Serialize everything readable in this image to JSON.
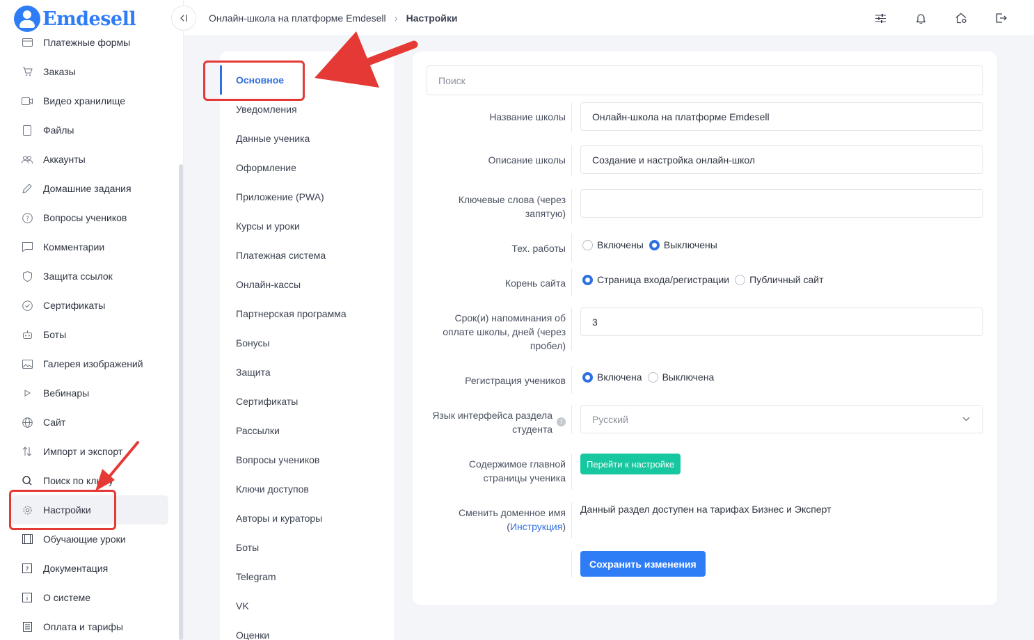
{
  "brand": {
    "name": "Emdesell"
  },
  "sidebar": {
    "items": [
      {
        "label": "Платежные формы",
        "icon": "credit-card-icon"
      },
      {
        "label": "Заказы",
        "icon": "cart-icon"
      },
      {
        "label": "Видео хранилище",
        "icon": "video-icon"
      },
      {
        "label": "Файлы",
        "icon": "file-icon"
      },
      {
        "label": "Аккаунты",
        "icon": "users-icon"
      },
      {
        "label": "Домашние задания",
        "icon": "pencil-icon"
      },
      {
        "label": "Вопросы учеников",
        "icon": "question-circle-icon"
      },
      {
        "label": "Комментарии",
        "icon": "comment-icon"
      },
      {
        "label": "Защита ссылок",
        "icon": "shield-icon"
      },
      {
        "label": "Сертификаты",
        "icon": "check-circle-icon"
      },
      {
        "label": "Боты",
        "icon": "robot-icon"
      },
      {
        "label": "Галерея изображений",
        "icon": "image-icon"
      },
      {
        "label": "Вебинары",
        "icon": "play-icon"
      },
      {
        "label": "Сайт",
        "icon": "globe-icon"
      },
      {
        "label": "Импорт и экспорт",
        "icon": "import-export-icon"
      },
      {
        "label": "Поиск по ключу",
        "icon": "search-icon"
      },
      {
        "label": "Настройки",
        "icon": "gear-icon",
        "active": true
      },
      {
        "label": "Обучающие уроки",
        "icon": "film-icon"
      },
      {
        "label": "Документация",
        "icon": "help-square-icon"
      },
      {
        "label": "О системе",
        "icon": "info-square-icon"
      },
      {
        "label": "Оплата и тарифы",
        "icon": "receipt-icon"
      }
    ]
  },
  "header": {
    "breadcrumb_root": "Онлайн-школа на платформе Emdesell",
    "breadcrumb_current": "Настройки",
    "icons": [
      "sliders-icon",
      "bell-icon",
      "home-settings-icon",
      "logout-icon"
    ]
  },
  "settings_menu": {
    "items": [
      "Основное",
      "Уведомления",
      "Данные ученика",
      "Оформление",
      "Приложение (PWA)",
      "Курсы и уроки",
      "Платежная система",
      "Онлайн-кассы",
      "Партнерская программа",
      "Бонусы",
      "Защита",
      "Сертификаты",
      "Рассылки",
      "Вопросы учеников",
      "Ключи доступов",
      "Авторы и кураторы",
      "Боты",
      "Telegram",
      "VK",
      "Оценки"
    ],
    "active_index": 0
  },
  "form": {
    "search_placeholder": "Поиск",
    "school_name": {
      "label": "Название школы",
      "value": "Онлайн-школа на платформе Emdesell"
    },
    "school_description": {
      "label": "Описание школы",
      "value": "Создание и настройка онлайн-школ"
    },
    "keywords": {
      "label_line1": "Ключевые слова (через",
      "label_line2": "запятую)",
      "value": ""
    },
    "maintenance": {
      "label": "Тех. работы",
      "options": [
        "Включены",
        "Выключены"
      ],
      "selected": "Выключены"
    },
    "site_root": {
      "label": "Корень сайта",
      "options": [
        "Страница входа/регистрации",
        "Публичный сайт"
      ],
      "selected": "Страница входа/регистрации"
    },
    "payment_reminder": {
      "label_line1": "Срок(и) напоминания об",
      "label_line2": "оплате школы, дней (через",
      "label_line3": "пробел)",
      "value": "3"
    },
    "student_registration": {
      "label": "Регистрация учеников",
      "options": [
        "Включена",
        "Выключена"
      ],
      "selected": "Включена"
    },
    "student_language": {
      "label_line1": "Язык интерфейса раздела",
      "label_line2": "студента",
      "value": "Русский"
    },
    "student_home": {
      "label_line1": "Содержимое главной",
      "label_line2": "страницы ученика",
      "button": "Перейти к настройке"
    },
    "domain": {
      "label_line1": "Сменить доменное имя",
      "label_paren_open": "(",
      "label_link": "Инструкция",
      "label_paren_close": ")",
      "text": "Данный раздел доступен на тарифах Бизнес и Эксперт"
    },
    "save_button": "Сохранить изменения"
  },
  "colors": {
    "accent": "#2f7df6",
    "active_link": "#2f6fe0",
    "green_button": "#16c7a0",
    "annotation_red": "#e53935"
  }
}
